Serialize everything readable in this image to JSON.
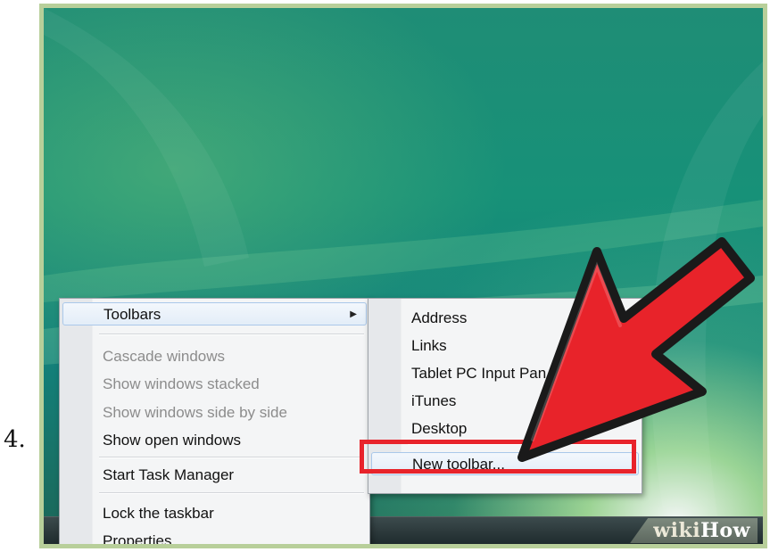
{
  "step": {
    "number": "4."
  },
  "context_menu": {
    "items": [
      {
        "label": "Toolbars",
        "state": "highlighted",
        "has_submenu": true
      },
      {
        "label": "Cascade windows",
        "state": "disabled"
      },
      {
        "label": "Show windows stacked",
        "state": "disabled"
      },
      {
        "label": "Show windows side by side",
        "state": "disabled"
      },
      {
        "label": "Show open windows",
        "state": "enabled"
      },
      {
        "label": "Start Task Manager",
        "state": "enabled"
      },
      {
        "label": "Lock the taskbar",
        "state": "enabled"
      },
      {
        "label": "Properties",
        "state": "enabled"
      }
    ],
    "submenu_arrow_icon": "triangle-right-icon"
  },
  "toolbars_submenu": {
    "items": [
      {
        "label": "Address",
        "state": "enabled"
      },
      {
        "label": "Links",
        "state": "enabled"
      },
      {
        "label": "Tablet PC Input Pan",
        "state": "enabled"
      },
      {
        "label": "iTunes",
        "state": "enabled"
      },
      {
        "label": "Desktop",
        "state": "enabled"
      },
      {
        "label": "New toolbar...",
        "state": "highlighted"
      }
    ]
  },
  "annotation": {
    "arrow_icon": "red-pointer-arrow-icon",
    "arrow_color": "#e8232a",
    "outline_color": "#1a1a1a",
    "highlight_box_color": "#e8232a"
  },
  "watermark": {
    "wiki": "wiki",
    "how": "How"
  },
  "colors": {
    "desktop_teal": "#179178",
    "menu_background": "#f4f5f6",
    "menu_hover_border": "#aac8ea"
  }
}
